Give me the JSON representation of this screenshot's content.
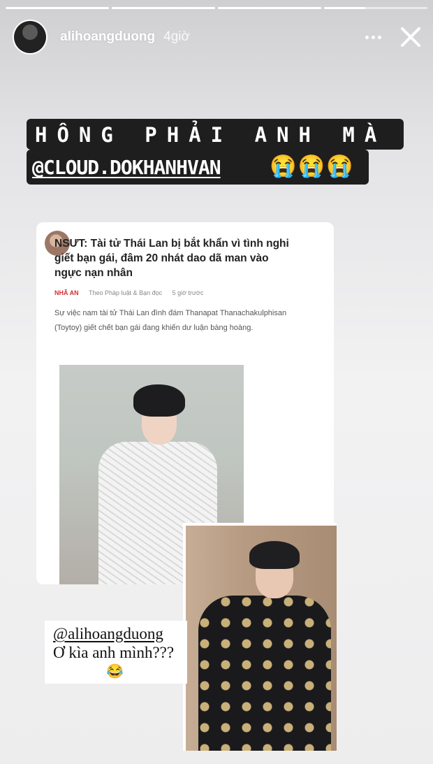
{
  "story": {
    "segments": [
      {
        "progress": 1.0
      },
      {
        "progress": 1.0
      },
      {
        "progress": 1.0
      },
      {
        "progress": 0.4
      }
    ],
    "username": "alihoangduong",
    "time": "4giờ",
    "more_icon": "more-dots-icon",
    "close_icon": "close-icon"
  },
  "caption": {
    "line1": "HÔNG PHẢI ANH MÀ",
    "mention": "@CLOUD.DOKHANHVAN",
    "emoji": "😭😭😭"
  },
  "article": {
    "headline": "NSƯT: Tài tử Thái Lan bị bắt khẩn vì tình nghi giết bạn gái, đâm 20 nhát dao dã man vào ngực nạn nhân",
    "source": "NHÃ AN",
    "publisher": "Theo Pháp luật & Bạn đọc",
    "time": "5 giờ trước",
    "summary": "Sự việc nam tài tử Thái Lan đình đám Thanapat Thanachakulphisan (Toytoy) giết chết bạn gái đang khiến dư luận bàng hoàng."
  },
  "sticker": {
    "mention": "@alihoangduong",
    "text": "Ơ kìa anh mình???",
    "emoji": "😂"
  }
}
